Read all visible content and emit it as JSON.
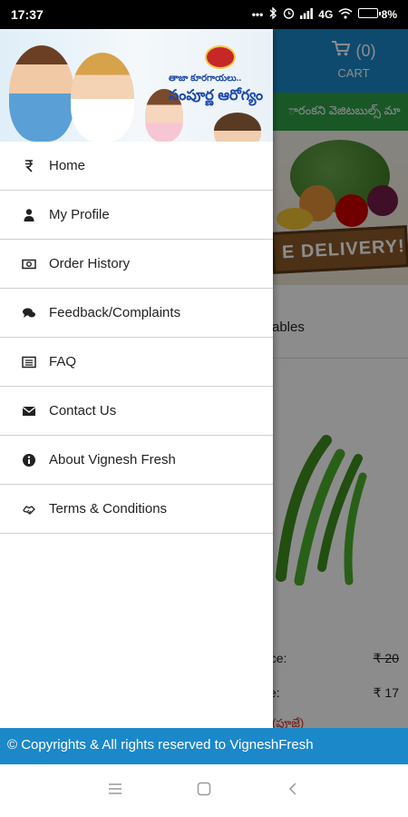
{
  "status_bar": {
    "time": "17:37",
    "icons": [
      "dots-icon",
      "bluetooth-icon",
      "alarm-icon",
      "signal-icon",
      "wifi-icon",
      "battery-icon"
    ],
    "network": "4G",
    "battery": "8%"
  },
  "app": {
    "cart_count": "(0)",
    "cart_label": "CART",
    "marquee": "ారంకని వెజిటబుల్స్ మా",
    "banner_text": "E DELIVERY!",
    "category_title": "ables",
    "price_label_1": "rice:",
    "price_value_1": "₹ 20",
    "price_label_2": "ce:",
    "price_value_2": "₹ 17",
    "telugu_name": "(పూజే)"
  },
  "drawer": {
    "header": {
      "brand_line1": "తాజా కూరగాయలు..",
      "brand_line2": "సంపూర్ణ ఆరోగ్యం"
    },
    "items": [
      {
        "label": "Home",
        "icon": "rupee-icon"
      },
      {
        "label": "My Profile",
        "icon": "user-icon"
      },
      {
        "label": "Order History",
        "icon": "money-icon"
      },
      {
        "label": "Feedback/Complaints",
        "icon": "comments-icon"
      },
      {
        "label": "FAQ",
        "icon": "list-icon"
      },
      {
        "label": "Contact Us",
        "icon": "envelope-icon"
      },
      {
        "label": "About Vignesh Fresh",
        "icon": "info-icon"
      },
      {
        "label": "Terms & Conditions",
        "icon": "handshake-icon"
      }
    ]
  },
  "footer": {
    "text": "© Copyrights & All rights reserved to VigneshFresh"
  },
  "colors": {
    "primary": "#1b88c9",
    "accent_green": "#2e9f48",
    "text": "#222222"
  }
}
